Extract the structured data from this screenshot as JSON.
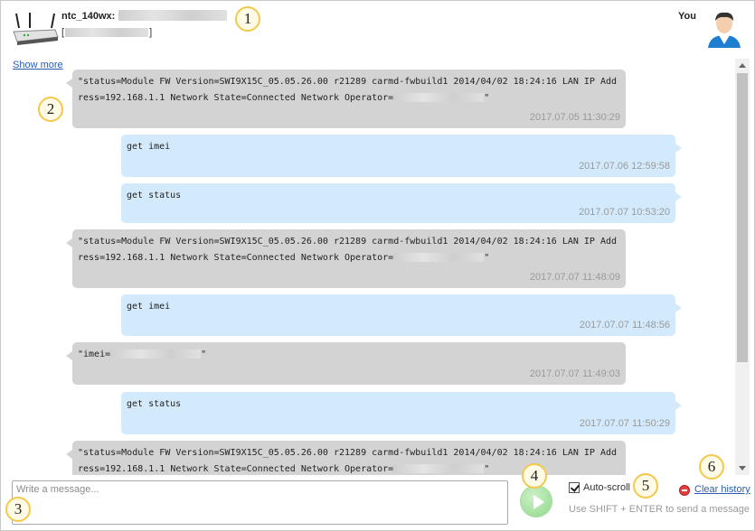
{
  "header": {
    "device_name": "ntc_140wx:",
    "device_sub_open": "[",
    "device_sub_close": "]",
    "you_label": "You"
  },
  "show_more": "Show more",
  "messages": [
    {
      "dir": "in",
      "text_before": "\"status=Module FW Version=SWI9X15C_05.05.26.00 r21289 carmd-fwbuild1 2014/04/02 18:24:16 LAN IP Address=192.168.1.1 Network State=Connected Network Operator=",
      "text_after": "\"",
      "time": "2017.07.05 11:30:29"
    },
    {
      "dir": "out",
      "text_before": "get imei",
      "text_after": "",
      "time": "2017.07.06 12:59:58"
    },
    {
      "dir": "out",
      "text_before": "get status",
      "text_after": "",
      "time": "2017.07.07 10:53:20"
    },
    {
      "dir": "in",
      "text_before": "\"status=Module FW Version=SWI9X15C_05.05.26.00 r21289 carmd-fwbuild1 2014/04/02 18:24:16 LAN IP Address=192.168.1.1 Network State=Connected Network Operator=",
      "text_after": "\"",
      "time": "2017.07.07 11:48:09"
    },
    {
      "dir": "out",
      "text_before": "get imei",
      "text_after": "",
      "time": "2017.07.07 11:48:56"
    },
    {
      "dir": "in",
      "text_before": "\"imei=",
      "text_after": "\"",
      "time": "2017.07.07 11:49:03"
    },
    {
      "dir": "out",
      "text_before": "get status",
      "text_after": "",
      "time": "2017.07.07 11:50:29"
    },
    {
      "dir": "in",
      "text_before": "\"status=Module FW Version=SWI9X15C_05.05.26.00 r21289 carmd-fwbuild1 2014/04/02 18:24:16 LAN IP Address=192.168.1.1 Network State=Connected Network Operator=",
      "text_after": "\"",
      "time": ""
    }
  ],
  "composer": {
    "placeholder": "Write a message...",
    "autoscroll_label": "Auto-scroll",
    "autoscroll_checked": true,
    "clear_history": "Clear history",
    "hint": "Use SHIFT + ENTER to send a message"
  },
  "callouts": [
    "1",
    "2",
    "3",
    "4",
    "5",
    "6"
  ],
  "colors": {
    "incoming_bubble": "#d3d3d3",
    "outgoing_bubble": "#d3eafc",
    "link": "#2a5db0",
    "callout_border": "#f2c94c"
  }
}
